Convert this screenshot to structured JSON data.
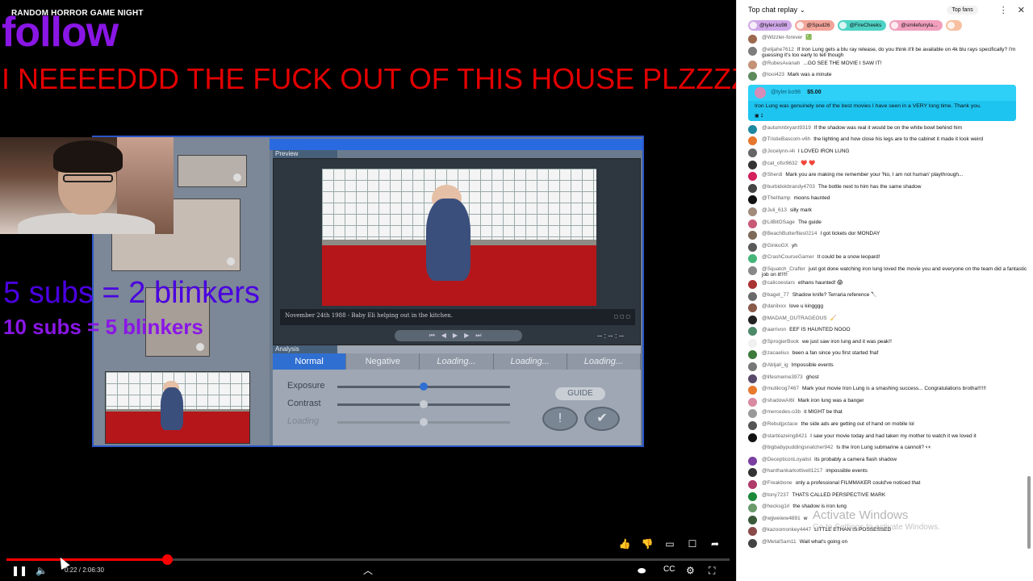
{
  "overlay": {
    "title": "RANDOM HORROR GAME NIGHT",
    "follow": "follow",
    "banner": "I NEEEEDDD THE FUCK OUT OF THIS HOUSE PLZZZZ",
    "sub_line_1": "5 subs = 2 blinkers",
    "sub_line_2": "10 subs = 5 blinkers"
  },
  "game": {
    "preview_label": "Preview",
    "caption": "November 24th 1988 - Baby Eli helping out in the kitchen.",
    "timecode": "-- : -- : --",
    "analysis_label": "Analysis",
    "tabs": [
      "Normal",
      "Negative",
      "Loading...",
      "Loading...",
      "Loading..."
    ],
    "slider_labels": [
      "Exposure",
      "Contrast",
      "Loading"
    ],
    "slider_levels": [
      0.5,
      0.5,
      0.5
    ],
    "guide_label": "GUIDE"
  },
  "player": {
    "time": "0:22 / 2:06:30",
    "progress_fraction": 0.222,
    "icons": [
      "like-icon",
      "dislike-icon",
      "comment-icon",
      "chat-icon",
      "share-icon"
    ]
  },
  "chat": {
    "title": "Top chat replay",
    "top_fans": "Top fans",
    "tickers": [
      {
        "name": "@tyler.ko98",
        "color": "#cfa8e8"
      },
      {
        "name": "@Spud26",
        "color": "#f3a49a"
      },
      {
        "name": "@FireCheeks",
        "color": "#4fd3c5"
      },
      {
        "name": "@smilefurryla...",
        "color": "#f0a0bd"
      },
      {
        "name": "",
        "color": "#f7c0a0"
      }
    ],
    "messages_top": [
      {
        "author": "@Wizzler-forever",
        "text": "💹",
        "avatar": "#9c6a4f"
      },
      {
        "author": "@elijahe7612",
        "text": "If Iron Lung gets a blu ray release, do you think it'll be available on 4k blu rays specifically? I'm guessing it's too early to tell though",
        "avatar": "#7d7d7d"
      },
      {
        "author": "@RubesAvanah",
        "text": "...GO SEE THE MOVIE I SAW IT!",
        "avatar": "#c49277"
      },
      {
        "author": "@tooi423",
        "text": "Mark was a minute",
        "avatar": "#5d8a5b"
      }
    ],
    "superchat": {
      "author": "@tyler.ko98",
      "amount": "$5.00",
      "text": "Iron Lung was genuinely one of the best movies I have seen in a VERY long time. Thank you.",
      "reactions": "1"
    },
    "messages": [
      {
        "author": "@autumnbryant9319",
        "text": "If the shadow was real it would be on the white bowl behind him",
        "avatar": "#1e88a0"
      },
      {
        "author": "@TristieBascom-v6h",
        "text": "the lighting and how close his legs are to the cabinet it made it look weird",
        "avatar": "#e8772e"
      },
      {
        "author": "@Jocelynn-i4i",
        "text": "I LOVED IRON LUNG",
        "avatar": "#666"
      },
      {
        "author": "@cat_ofsr9632",
        "text": "❤️ ❤️",
        "avatar": "#333"
      },
      {
        "author": "@Sherdi",
        "text": "Mark you are making me remember your 'No, I am not human' playthrough...",
        "avatar": "#d4215c"
      },
      {
        "author": "@burbidokbrandy4703",
        "text": "The bottle next to him has the same shadow",
        "avatar": "#444"
      },
      {
        "author": "@TheItlamp",
        "text": "moons haunted",
        "avatar": "#111"
      },
      {
        "author": "@Juli_613",
        "text": "silly mark",
        "avatar": "#a18b7b"
      },
      {
        "author": "@LilBitOSage",
        "text": "The guide",
        "avatar": "#c85a78"
      },
      {
        "author": "@BeachButterflies0214",
        "text": "I got tickets dor MONDAY",
        "avatar": "#7d6a58"
      },
      {
        "author": "@GinkoGX",
        "text": "yh",
        "avatar": "#5a5a5a"
      },
      {
        "author": "@CrashCourseGamer",
        "text": "It could be a snow leopard!",
        "avatar": "#45b57a"
      },
      {
        "author": "@Squatch_Crafter",
        "text": "just got done watching iron lung loved the movie you and everyone on the team did a fantastic job on it!!!!!",
        "avatar": "#888"
      },
      {
        "author": "@calicoestars",
        "text": "ethans haunted! 😱",
        "avatar": "#a33"
      },
      {
        "author": "@baget_77",
        "text": "Shadow knife? Terraria reference 🔪",
        "avatar": "#6a6a6a"
      },
      {
        "author": "@danilxxx",
        "text": "love u kingggg",
        "avatar": "#8a5a4a"
      },
      {
        "author": "@MADAM_OUTRAGEOUS",
        "text": "🧹",
        "avatar": "#222"
      },
      {
        "author": "@aarrivon",
        "text": "EEF IS HAUNTED NOOO",
        "avatar": "#4c8a6a"
      },
      {
        "author": "@SprogierBook",
        "text": "we just saw iron lung and it was peak!!",
        "avatar": "#f0f0f0"
      },
      {
        "author": "@zacaelius",
        "text": "been a fan since you first started fnaf",
        "avatar": "#3c7a3c"
      },
      {
        "author": "@Abljall_ig",
        "text": "Impossible events",
        "avatar": "#777"
      },
      {
        "author": "@lifesmeme3973",
        "text": "ghost",
        "avatar": "#5a4a6a"
      },
      {
        "author": "@mutikrog7467",
        "text": "Mark your movie Iron Lung is a smashing success... Congratulations brotha!!!!!!",
        "avatar": "#e87a2e"
      },
      {
        "author": "@shadowAI6I",
        "text": "Mark iron lung was a banger",
        "avatar": "#d88aa0"
      },
      {
        "author": "@mercedes-o3b",
        "text": "it MIGHT be that",
        "avatar": "#999"
      },
      {
        "author": "@Rebutjpctace",
        "text": "the side ads are getting out of hand on mobile lol",
        "avatar": "#555"
      },
      {
        "author": "@starblazeing8421",
        "text": "I saw your movie today and had taken my mother to watch it we loved it",
        "avatar": "#111"
      },
      {
        "author": "@bigbabypuddingsnatcher942",
        "text": "Is the Iron Lung submarine a cannoli? 👀",
        "avatar": "#ffffff"
      },
      {
        "author": "@DecepticonLoyalist",
        "text": "its probably a camera flash shadow",
        "avatar": "#7a3fa0"
      },
      {
        "author": "@hanthankarkottivell1217",
        "text": "impossible events",
        "avatar": "#333"
      },
      {
        "author": "@Freakbone",
        "text": "only a professional FILMMAKER could've noticed that",
        "avatar": "#b03a6a"
      },
      {
        "author": "@tony7237",
        "text": "THATS CALLED PERSPECTIVE MARK",
        "avatar": "#1a8a3a"
      },
      {
        "author": "@hecksg1rl",
        "text": "the shadow is iron lung",
        "avatar": "#6a9a6a"
      },
      {
        "author": "@wjjweiww4891",
        "text": "w",
        "avatar": "#3a5a3a"
      },
      {
        "author": "@kazoomonkey4447",
        "text": "LITTLE ETHAN IS POSSESSED",
        "avatar": "#8a4a4a"
      },
      {
        "author": "@MetalSam11",
        "text": "Wait what's going on",
        "avatar": "#444"
      }
    ]
  },
  "watermark": {
    "line1": "Activate Windows",
    "line2": "Go to Settings to activate Windows."
  }
}
